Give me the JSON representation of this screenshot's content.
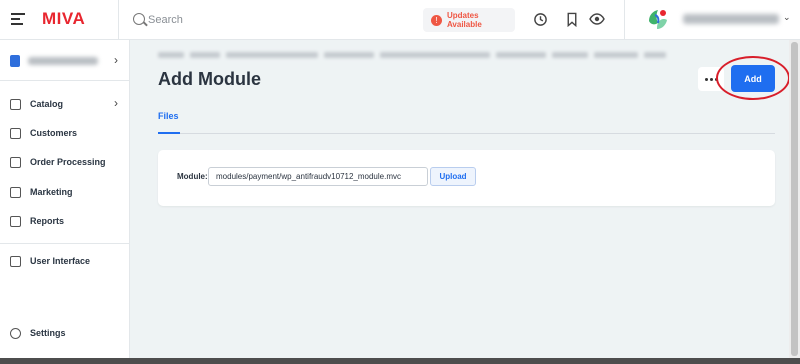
{
  "header": {
    "logo": "MIVA",
    "search_placeholder": "Search",
    "updates_label": "Updates Available",
    "icons": [
      "menu-icon",
      "search-icon",
      "history-icon",
      "bookmark-icon",
      "eye-icon",
      "chevron-down-icon"
    ]
  },
  "sidebar": {
    "items": [
      {
        "label": "Catalog",
        "icon": "catalog-icon",
        "has_chevron": true
      },
      {
        "label": "Customers",
        "icon": "customers-icon"
      },
      {
        "label": "Order Processing",
        "icon": "order-processing-icon"
      },
      {
        "label": "Marketing",
        "icon": "marketing-icon"
      },
      {
        "label": "Reports",
        "icon": "reports-icon"
      },
      {
        "label": "User Interface",
        "icon": "user-interface-icon"
      },
      {
        "label": "Settings",
        "icon": "settings-icon"
      }
    ]
  },
  "main": {
    "title": "Add Module",
    "add_label": "Add",
    "tabs": [
      {
        "label": "Files"
      }
    ],
    "form": {
      "module_label": "Module:",
      "module_value": "modules/payment/wp_antifraudv10712_module.mvc",
      "upload_label": "Upload"
    }
  },
  "colors": {
    "brand": "#e8262f",
    "accent": "#1f6ef0",
    "highlight": "#d81e2a",
    "updates": "#ef5744"
  }
}
